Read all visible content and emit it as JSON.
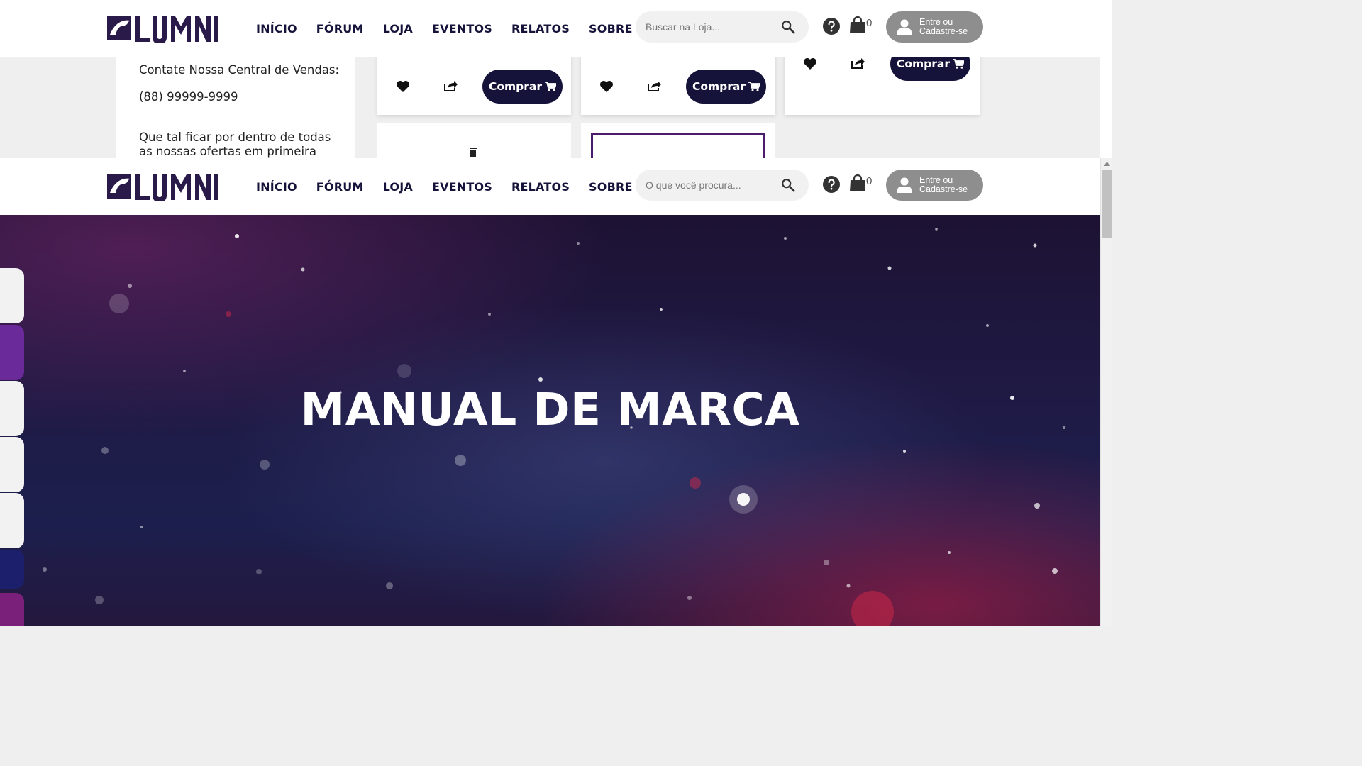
{
  "brand": {
    "name": "LUMNI"
  },
  "nav": {
    "items": [
      {
        "label": "INÍCIO"
      },
      {
        "label": "FÓRUM"
      },
      {
        "label": "LOJA"
      },
      {
        "label": "EVENTOS"
      },
      {
        "label": "RELATOS"
      },
      {
        "label": "SOBRE NÓS"
      }
    ]
  },
  "header_top": {
    "search_placeholder": "Buscar na Loja...",
    "cart_count": "0",
    "login_label": "Entre ou Cadastre-se"
  },
  "header_bottom": {
    "search_placeholder": "O que você procura...",
    "cart_count": "0",
    "login_label": "Entre ou Cadastre-se"
  },
  "store_sidebar": {
    "contact_title": "Contate Nossa Central de Vendas:",
    "contact_phone": "(88) 99999-9999",
    "newsletter_text": "Que tal ficar por dentro de todas as nossas ofertas em primeira mão?"
  },
  "product_cards": [
    {
      "buy_label": "Comprar"
    },
    {
      "buy_label": "Comprar"
    },
    {
      "buy_label": "Comprar"
    }
  ],
  "hero": {
    "title": "MANUAL DE MARCA"
  },
  "side_tabs": [
    {
      "color": "#f2f2f2"
    },
    {
      "color": "#6a2a9a"
    },
    {
      "color": "#f2f2f2"
    },
    {
      "color": "#f2f2f2"
    },
    {
      "color": "#f2f2f2"
    },
    {
      "color": "#1c1f6b"
    },
    {
      "color": "#7a1f7a"
    }
  ],
  "colors": {
    "primary": "#16133a",
    "accent_purple": "#4b1c6b",
    "login_bg": "#8e8e8e",
    "search_bg": "#f1f1f1"
  },
  "icons": {
    "search": "search-icon",
    "help": "question-circle-icon",
    "cart": "shopping-bag-icon",
    "user": "user-icon",
    "favorite": "heart-icon",
    "share": "share-icon",
    "buy_cart": "cart-icon"
  }
}
